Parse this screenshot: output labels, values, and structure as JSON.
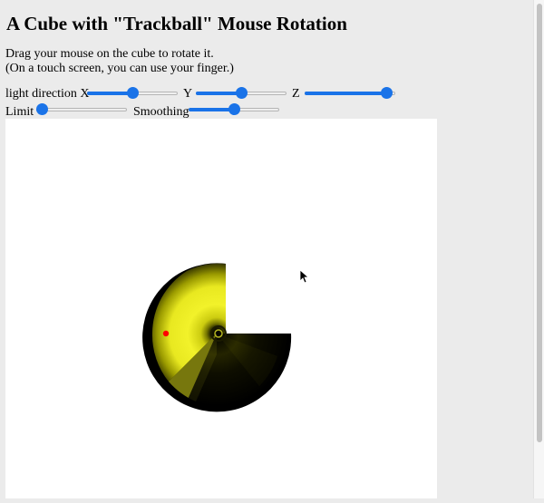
{
  "heading": "A Cube with \"Trackball\" Mouse Rotation",
  "instructions": {
    "line1": "Drag your mouse on the cube to rotate it.",
    "line2": "(On a touch screen, you can use your finger.)"
  },
  "controls": {
    "light_direction_label": "light direction X",
    "y_label": "Y",
    "z_label": "Z",
    "limit_label": "Limit",
    "smoothing_label": "Smoothing",
    "light_x_fraction": 0.5,
    "light_y_fraction": 0.5,
    "light_z_fraction": 0.95,
    "limit_fraction": 0.0,
    "smoothing_fraction": 0.5
  },
  "colors": {
    "slider_accent": "#1a73e8",
    "cube_light": "#ffff33",
    "cube_shadow": "#000000",
    "marker": "#ff0000"
  },
  "icons": {
    "cursor": "mouse-pointer-icon"
  }
}
